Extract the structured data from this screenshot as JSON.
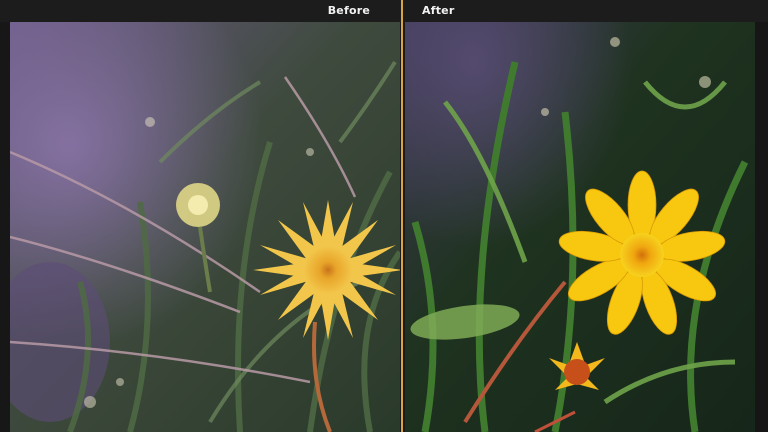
{
  "compare": {
    "before_label": "Before",
    "after_label": "After"
  },
  "colors": {
    "divider": "#d9a441",
    "bar": "#1c1c1c",
    "label": "#f2f2f2"
  },
  "icons": {
    "divider": "split-divider-handle"
  }
}
